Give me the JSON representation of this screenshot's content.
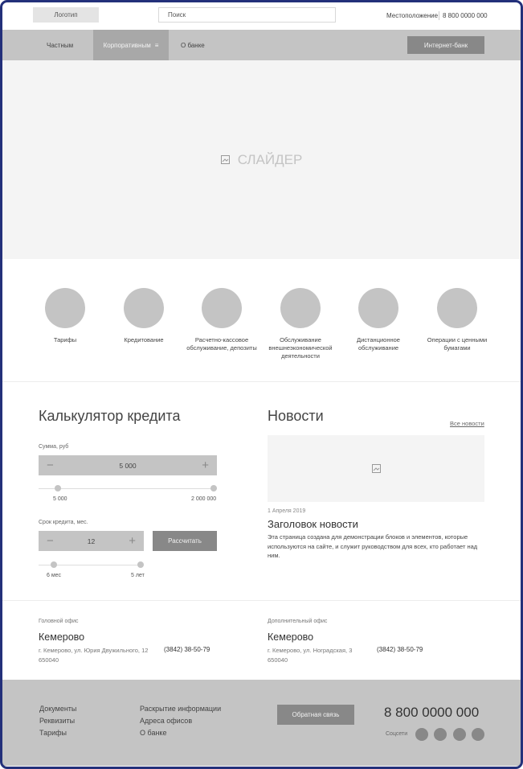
{
  "header": {
    "logo": "Логотип",
    "search_placeholder": "Поиск",
    "location": "Местоположение",
    "phone": "8 800 0000 000"
  },
  "nav": {
    "items": [
      "Частным",
      "Корпоративным",
      "О банке"
    ],
    "internet_bank": "Интернет-банк"
  },
  "slider": {
    "label": "СЛАЙДЕР"
  },
  "services": [
    "Тарифы",
    "Кредитование",
    "Расчетно-кассовое обслуживание, депозиты",
    "Обслуживание внешнеэкономической деятельности",
    "Дистанционное обслуживание",
    "Операции с ценными бумагами"
  ],
  "calculator": {
    "title": "Калькулятор кредита",
    "sum_label": "Сумма, руб",
    "sum_value": "5 000",
    "sum_min": "5 000",
    "sum_max": "2 000 000",
    "sum_fraction": 0,
    "term_label": "Срок кредита, мес.",
    "term_value": "12",
    "term_min": "6 мес",
    "term_max": "5 лет",
    "term_fraction": 0.0,
    "calc_button": "Рассчитать"
  },
  "news": {
    "title": "Новости",
    "all_link": "Все новости",
    "date": "1 Апреля 2019",
    "headline": "Заголовок новости",
    "text": "Эта страница создана для демонстрации блоков и элементов, которые используются на сайте, и служит руководством для всех, кто работает над ним."
  },
  "offices": [
    {
      "type": "Головной офис",
      "city": "Кемерово",
      "address": "г. Кемерово, ул. Юрия Двужильного, 12",
      "zip": "650040",
      "phone": "(3842) 38-50-79"
    },
    {
      "type": "Дополнительный офис",
      "city": "Кемерово",
      "address": "г. Кемерово, ул. Ноградская, 3",
      "zip": "650040",
      "phone": "(3842) 38-50-79"
    }
  ],
  "footer": {
    "col1": [
      "Документы",
      "Реквизиты",
      "Тарифы"
    ],
    "col2": [
      "Раскрытие информации",
      "Адреса офисов",
      "О банке"
    ],
    "feedback": "Обратная связь",
    "phone": "8 800 0000 000",
    "social_label": "Соцсети"
  }
}
